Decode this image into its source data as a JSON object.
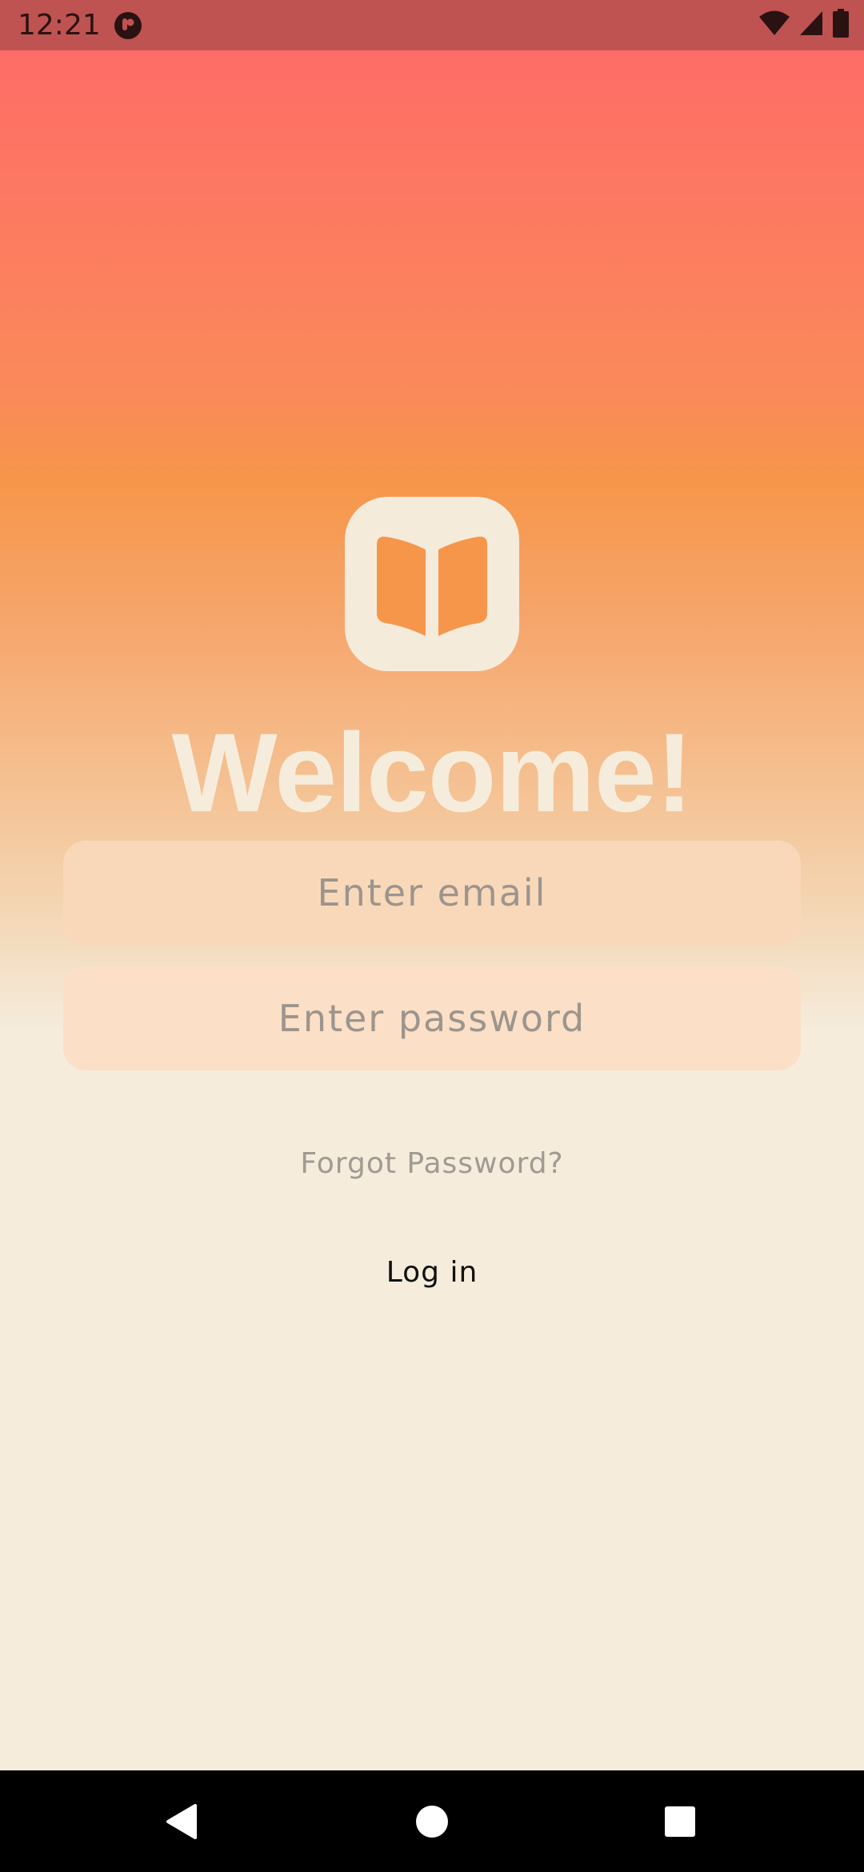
{
  "status_bar": {
    "time": "12:21",
    "background": "#bf5352"
  },
  "logo": {
    "icon": "open-book-icon",
    "tile_color": "#f5ebdb",
    "icon_color": "#f6964a"
  },
  "welcome": {
    "title": "Welcome!"
  },
  "form": {
    "email_placeholder": "Enter email",
    "email_value": "",
    "password_placeholder": "Enter password",
    "password_value": "",
    "forgot_label": "Forgot Password?",
    "login_label": "Log in"
  },
  "nav_bar": {
    "back_icon": "back-triangle-icon",
    "home_icon": "home-circle-icon",
    "recents_icon": "recents-square-icon"
  },
  "colors": {
    "gradient_top": "#ff6c67",
    "gradient_mid": "#f6964a",
    "gradient_bottom": "#f5ecdc"
  }
}
